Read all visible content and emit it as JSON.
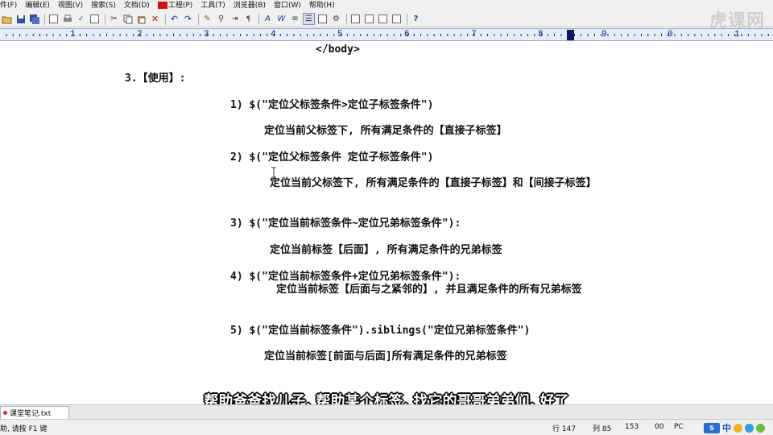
{
  "menu": {
    "items": [
      "件(F)",
      "编辑(E)",
      "视图(V)",
      "搜索(S)",
      "文档(D)",
      "工程(P)",
      "工具(T)",
      "浏览器(B)",
      "窗口(W)",
      "帮助(H)"
    ]
  },
  "watermark": "虎课网",
  "ruler": {
    "numbers": [
      "1",
      "2",
      "3",
      "4",
      "5",
      "6",
      "7",
      "8",
      "9",
      "0",
      "1"
    ]
  },
  "editor": {
    "lines": [
      "</body>",
      "3.【使用】:",
      "1)  $(\"定位父标签条件>定位子标签条件\")",
      "定位当前父标签下, 所有满足条件的【直接子标签】",
      "2)   $(\"定位父标签条件 定位子标签条件\")",
      "定位当前父标签下, 所有满足条件的【直接子标签】和【间接子标签】",
      "3)   $(\"定位当前标签条件~定位兄弟标签条件\"):",
      "定位当前标签【后面】, 所有满足条件的兄弟标签",
      "4)   $(\"定位当前标签条件+定位兄弟标签条件\"):",
      "定位当前标签【后面与之紧邻的】, 并且满足条件的所有兄弟标签",
      "5)  $(\"定位当前标签条件\").siblings(\"定位兄弟标签条件\")",
      "定位当前标签[前面与后面]所有满足条件的兄弟标签"
    ]
  },
  "subtitle": "帮助爸爸找儿子, 帮助某个标签, 找它的哥哥弟弟们, 好了",
  "tabs": [
    {
      "label": "课堂笔记.txt"
    }
  ],
  "status": {
    "help": "助, 请按 F1 键",
    "line": "行 147",
    "col": "列 85",
    "num": "153",
    "code": "00",
    "mode": "PC",
    "ime": "中"
  }
}
